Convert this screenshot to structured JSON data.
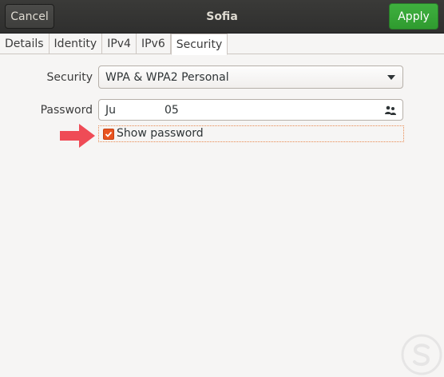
{
  "header": {
    "cancel_label": "Cancel",
    "title": "Sofia",
    "apply_label": "Apply"
  },
  "tabs": [
    {
      "label": "Details",
      "active": false
    },
    {
      "label": "Identity",
      "active": false
    },
    {
      "label": "IPv4",
      "active": false
    },
    {
      "label": "IPv6",
      "active": false
    },
    {
      "label": "Security",
      "active": true
    }
  ],
  "form": {
    "security_label": "Security",
    "security_value": "WPA & WPA2 Personal",
    "password_label": "Password",
    "password_value_part1": "Ju",
    "password_value_part2": "05",
    "password_icon": "people-icon",
    "show_password_label": "Show password",
    "show_password_checked": true
  },
  "colors": {
    "accent": "#e95420",
    "apply_green": "#33a533",
    "arrow_red": "#ef4b56",
    "titlebar": "#333332"
  },
  "watermark": {
    "icon": "brand-s-logo"
  }
}
